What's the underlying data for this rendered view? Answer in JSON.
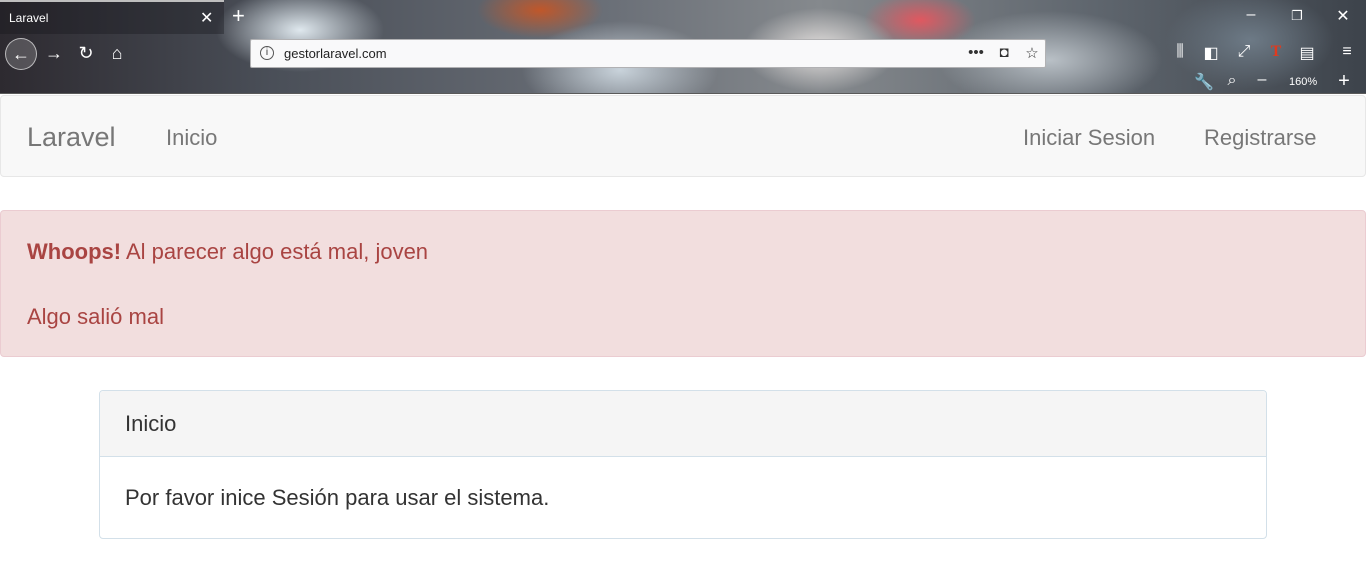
{
  "browser": {
    "tab_title": "Laravel",
    "url": "gestorlaravel.com",
    "zoom_level": "160%"
  },
  "navbar": {
    "brand": "Laravel",
    "links": [
      "Inicio"
    ],
    "right_links": [
      "Iniciar Sesion",
      "Registrarse"
    ]
  },
  "alert": {
    "strong": "Whoops!",
    "message": " Al parecer algo está mal, joven",
    "error": "Algo salió mal"
  },
  "panel": {
    "heading": "Inicio",
    "body": "Por favor inice Sesión para usar el sistema."
  },
  "colors": {
    "alert_bg": "#f2dede",
    "alert_text": "#a94442",
    "navbar_bg": "#f8f8f8",
    "panel_heading_bg": "#f5f5f5"
  },
  "icons": [
    "close-icon",
    "plus-icon",
    "minimize-icon",
    "restore-icon",
    "back-arrow-icon",
    "forward-arrow-icon",
    "reload-icon",
    "home-icon",
    "info-icon",
    "more-icon",
    "pocket-icon",
    "star-icon",
    "library-icon",
    "sidebar-icon",
    "fullscreen-icon",
    "text-icon",
    "reader-icon",
    "menu-icon",
    "wrench-icon",
    "zoom-icon",
    "zoom-out-icon",
    "zoom-in-icon"
  ]
}
